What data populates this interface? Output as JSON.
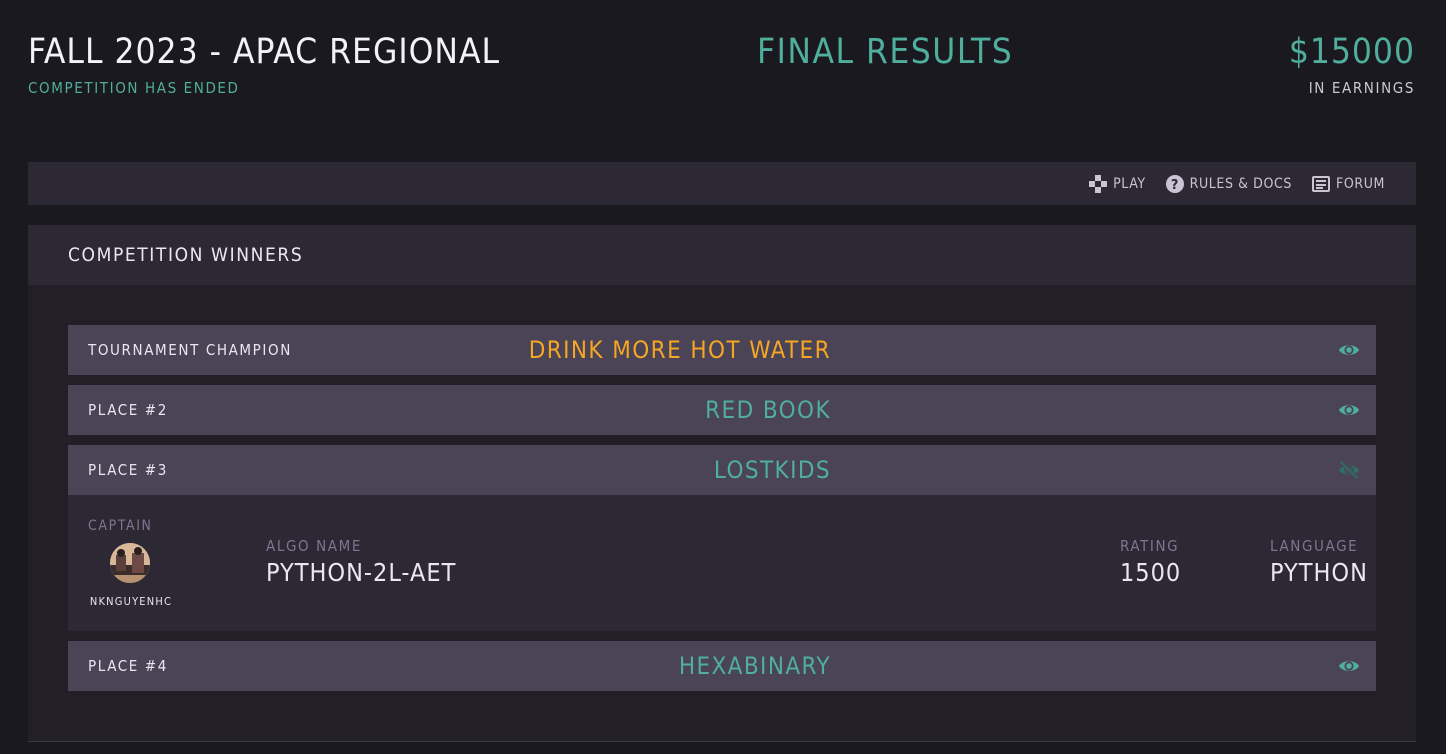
{
  "header": {
    "title": "FALL 2023 - APAC REGIONAL",
    "subtitle": "COMPETITION HAS ENDED",
    "status": "FINAL RESULTS",
    "prize_amount": "$15000",
    "prize_label": "IN EARNINGS"
  },
  "nav": {
    "items": [
      {
        "label": "PLAY",
        "icon": "gamepad-icon"
      },
      {
        "label": "RULES & DOCS",
        "icon": "question-icon"
      },
      {
        "label": "FORUM",
        "icon": "newspaper-icon"
      }
    ]
  },
  "winners": {
    "heading": "COMPETITION WINNERS",
    "rows": [
      {
        "place": "TOURNAMENT CHAMPION",
        "team": "DRINK MORE HOT WATER",
        "icon": "eye-icon"
      },
      {
        "place": "PLACE #2",
        "team": "RED BOOK",
        "icon": "eye-icon"
      },
      {
        "place": "PLACE #3",
        "team": "LOSTKIDS",
        "icon": "eye-off-icon"
      },
      {
        "place": "PLACE #4",
        "team": "HEXABINARY",
        "icon": "eye-icon"
      }
    ],
    "expanded": {
      "captain_label": "CAPTAIN",
      "captain_name": "NKNGUYENHC",
      "algo_label": "ALGO NAME",
      "algo_name": "PYTHON-2L-AET",
      "rating_label": "RATING",
      "rating": "1500",
      "language_label": "LANGUAGE",
      "language": "PYTHON"
    }
  },
  "colors": {
    "background": "#1b1920",
    "accent": "#4fae9c",
    "champion": "#f5a623",
    "row": "#4a4456",
    "bar": "#2c2934"
  }
}
